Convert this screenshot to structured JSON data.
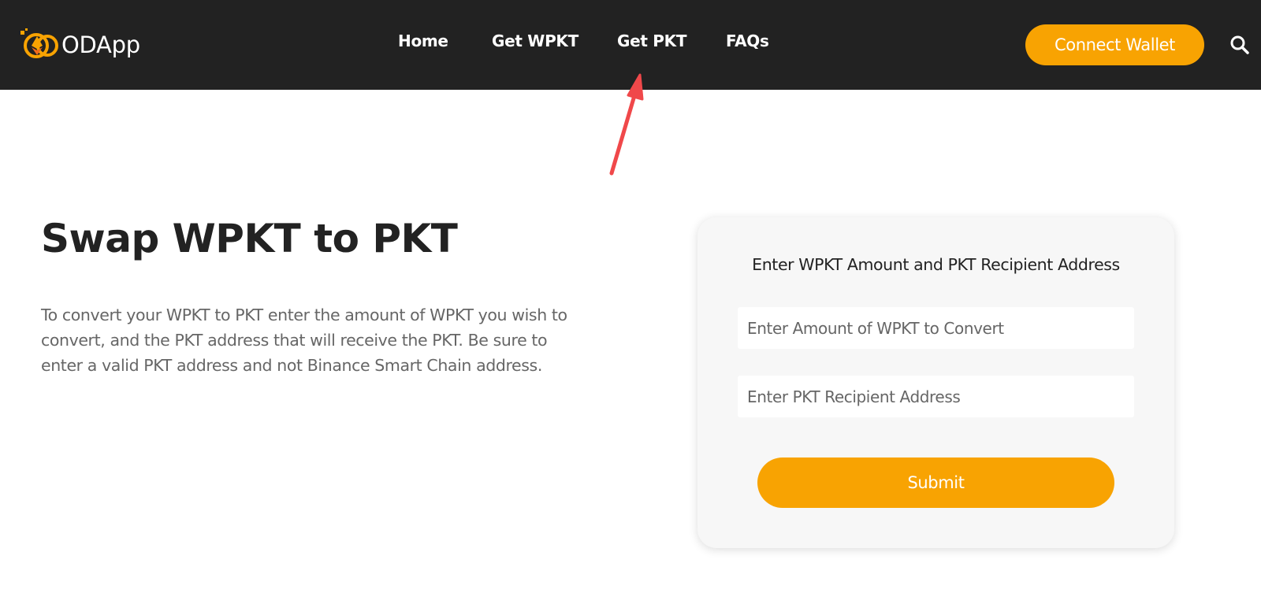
{
  "header": {
    "logo_text": "ODApp",
    "nav": [
      {
        "label": "Home"
      },
      {
        "label": "Get WPKT"
      },
      {
        "label": "Get PKT"
      },
      {
        "label": "FAQs"
      }
    ],
    "connect_label": "Connect Wallet",
    "search_icon": "search-icon"
  },
  "main": {
    "title": "Swap WPKT to PKT",
    "description": "To convert your WPKT to PKT enter the amount of WPKT you wish to convert, and the PKT address that will receive the PKT. Be sure to enter a valid PKT address and not Binance Smart Chain address."
  },
  "form": {
    "title": "Enter WPKT Amount and PKT Recipient Address",
    "amount_placeholder": "Enter Amount of WPKT to Convert",
    "address_placeholder": "Enter PKT Recipient Address",
    "submit_label": "Submit"
  },
  "colors": {
    "accent": "#f8a302",
    "header_bg": "#222222",
    "annotation_arrow": "#f0484a"
  }
}
